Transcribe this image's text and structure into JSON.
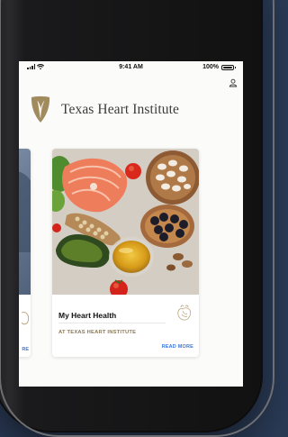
{
  "status_bar": {
    "time": "9:41 AM",
    "battery": "100%"
  },
  "header": {
    "brand": "Texas Heart Institute",
    "profile_icon": "user-icon",
    "logo_icon": "heart-shield-logo-icon"
  },
  "cards": [
    {
      "title": "My Heart Health",
      "subtitle": "AT TEXAS HEART INSTITUTE",
      "action": "READ MORE",
      "icon": "anatomical-heart-icon"
    },
    {
      "action": "RE"
    }
  ],
  "colors": {
    "accent": "#3d78d8",
    "subtitle": "#8a7a5a",
    "logo": "#a18b5e"
  }
}
